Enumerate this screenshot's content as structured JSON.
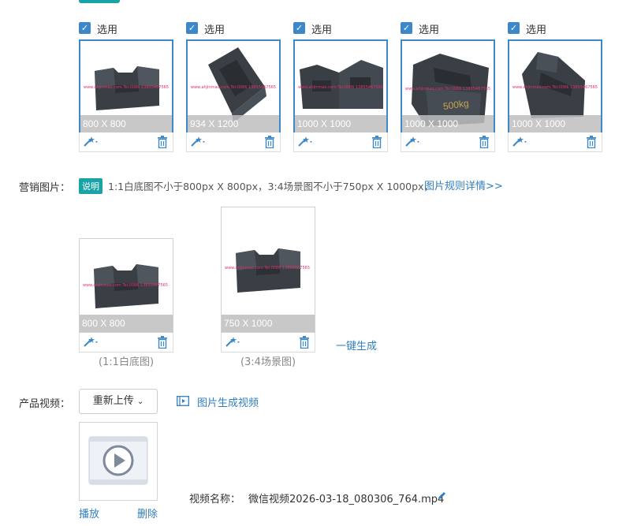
{
  "selection_items": [
    {
      "label": "选用",
      "dims": "800 X 800"
    },
    {
      "label": "选用",
      "dims": "934 X 1200"
    },
    {
      "label": "选用",
      "dims": "1000 X 1000"
    },
    {
      "label": "选用",
      "dims": "1000 X 1000"
    },
    {
      "label": "选用",
      "dims": "1000 X 1000"
    }
  ],
  "marketing": {
    "label": "营销图片：",
    "badge": "说明",
    "hint": "1:1白底图不小于800px X 800px，3:4场景图不小于750px X 1000px，",
    "rules_link": "图片规则详情>>",
    "images": [
      {
        "dims": "800 X 800",
        "caption": "(1:1白底图)"
      },
      {
        "dims": "750 X 1000",
        "caption": "(3:4场景图)"
      }
    ],
    "generate_link": "一键生成"
  },
  "video": {
    "label": "产品视频：",
    "reupload": "重新上传",
    "to_video_link": "图片生成视频",
    "play": "播放",
    "delete": "删除",
    "name_label": "视频名称：",
    "name_value": "微信视频2026-03-18_080306_764.mp4"
  },
  "icons": {
    "check": "check-icon",
    "wand": "magic-wand-icon",
    "trash": "trash-icon",
    "film": "film-icon",
    "pencil": "pencil-icon",
    "play": "play-icon"
  },
  "colors": {
    "accent": "#3d88c8",
    "teal": "#1aa3a6",
    "link": "#2f7fc1"
  }
}
